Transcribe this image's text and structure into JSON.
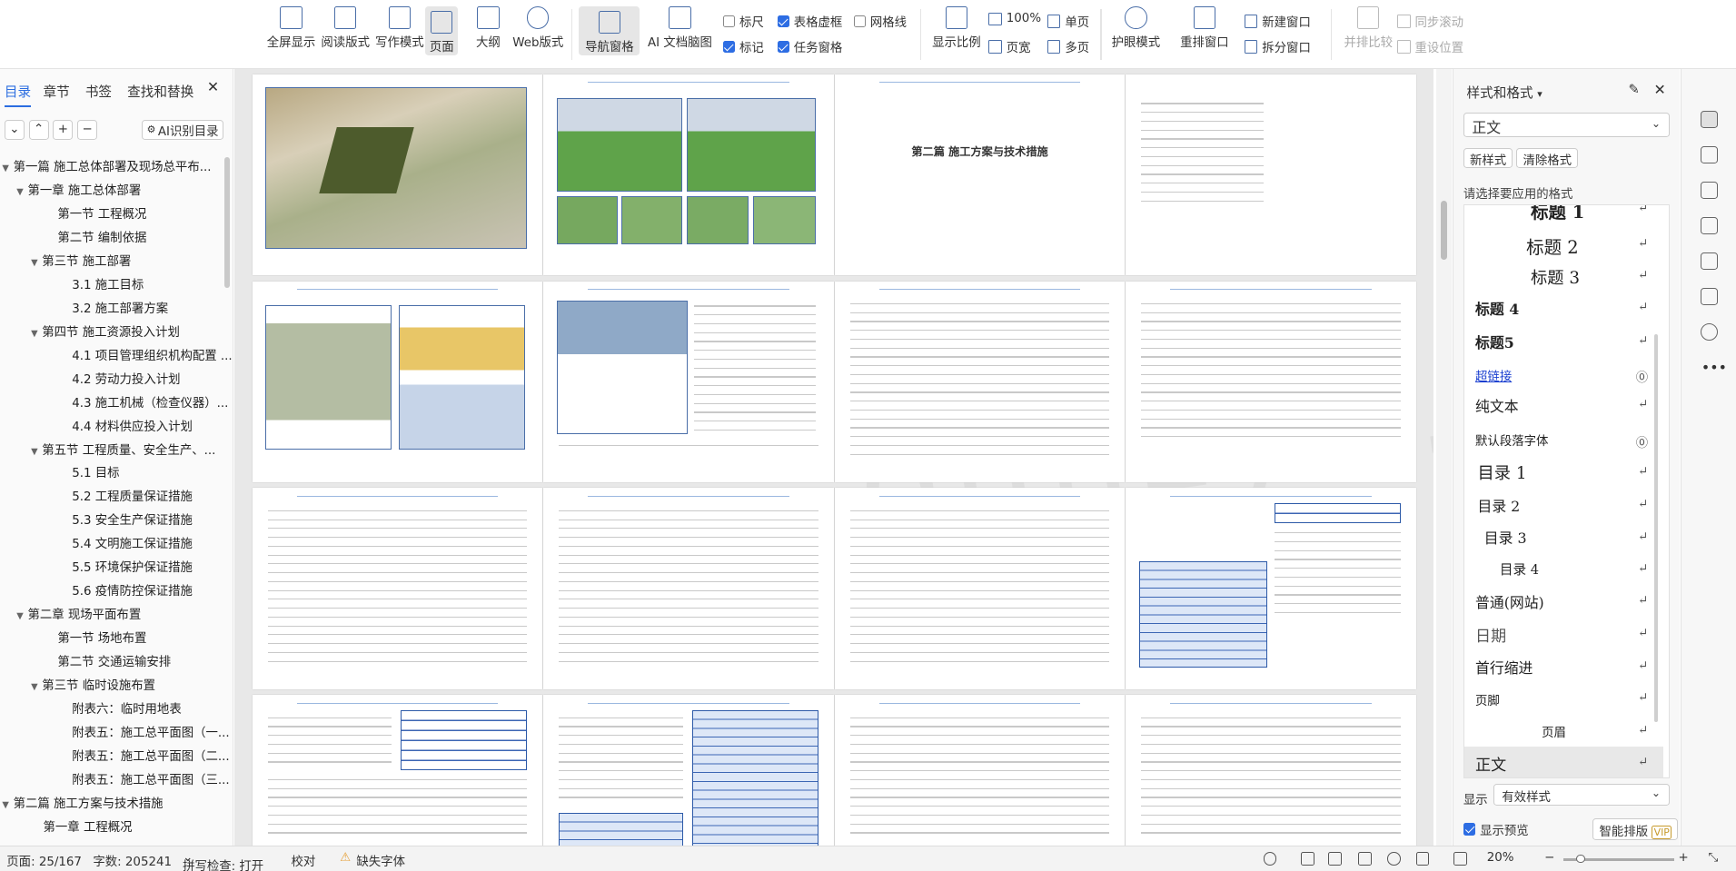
{
  "ribbon": {
    "fullscreen": "全屏显示",
    "reading": "阅读版式",
    "writing": "写作模式",
    "page": "页面",
    "outline": "大纲",
    "web": "Web版式",
    "nav_pane": "导航窗格",
    "ai_map": "AI 文档脑图",
    "ruler": "标尺",
    "table_dash": "表格虚框",
    "gridlines": "网格线",
    "marks": "标记",
    "task_pane": "任务窗格",
    "display_ratio": "显示比例",
    "zoom100": "100%",
    "page_width": "页宽",
    "single_page": "单页",
    "multi_page": "多页",
    "eye_mode": "护眼模式",
    "rearrange": "重排窗口",
    "new_window": "新建窗口",
    "split_window": "拆分窗口",
    "side_by_side": "并排比较",
    "sync_scroll": "同步滚动",
    "reset_pos": "重设位置"
  },
  "left_panel": {
    "tabs": [
      "目录",
      "章节",
      "书签",
      "查找和替换"
    ],
    "ai_toc": "AI识别目录",
    "toc": [
      {
        "t": "第一篇  施工总体部署及现场总平布...",
        "lvl": 0,
        "arrow": true
      },
      {
        "t": "第一章 施工总体部署",
        "lvl": 1,
        "arrow": true
      },
      {
        "t": "第一节 工程概况",
        "lvl": 2,
        "arrow": false
      },
      {
        "t": "第二节 编制依据",
        "lvl": 2,
        "arrow": false
      },
      {
        "t": "第三节 施工部署",
        "lvl": 2,
        "arrow": true
      },
      {
        "t": "3.1 施工目标",
        "lvl": 3,
        "arrow": false
      },
      {
        "t": "3.2 施工部署方案",
        "lvl": 3,
        "arrow": false
      },
      {
        "t": "第四节 施工资源投入计划",
        "lvl": 2,
        "arrow": true
      },
      {
        "t": "4.1 项目管理组织机构配置 ...",
        "lvl": 3,
        "arrow": false
      },
      {
        "t": "4.2 劳动力投入计划",
        "lvl": 3,
        "arrow": false
      },
      {
        "t": "4.3 施工机械（检查仪器）...",
        "lvl": 3,
        "arrow": false
      },
      {
        "t": "4.4 材料供应投入计划",
        "lvl": 3,
        "arrow": false
      },
      {
        "t": "第五节 工程质量、安全生产、...",
        "lvl": 2,
        "arrow": true
      },
      {
        "t": "5.1 目标",
        "lvl": 3,
        "arrow": false
      },
      {
        "t": "5.2 工程质量保证措施",
        "lvl": 3,
        "arrow": false
      },
      {
        "t": "5.3 安全生产保证措施",
        "lvl": 3,
        "arrow": false
      },
      {
        "t": "5.4 文明施工保证措施",
        "lvl": 3,
        "arrow": false
      },
      {
        "t": "5.5 环境保护保证措施",
        "lvl": 3,
        "arrow": false
      },
      {
        "t": "5.6 疫情防控保证措施",
        "lvl": 3,
        "arrow": false
      },
      {
        "t": "第二章 现场平面布置",
        "lvl": 1,
        "arrow": true
      },
      {
        "t": "第一节 场地布置",
        "lvl": 2,
        "arrow": false
      },
      {
        "t": "第二节 交通运输安排",
        "lvl": 2,
        "arrow": false
      },
      {
        "t": "第三节 临时设施布置",
        "lvl": 2,
        "arrow": true
      },
      {
        "t": "附表六：临时用地表",
        "lvl": 3,
        "arrow": false
      },
      {
        "t": "附表五：施工总平面图（一...",
        "lvl": 3,
        "arrow": false
      },
      {
        "t": "附表五：施工总平面图（二...",
        "lvl": 3,
        "arrow": false
      },
      {
        "t": "附表五：施工总平面图（三...",
        "lvl": 3,
        "arrow": false
      },
      {
        "t": "第二篇 施工方案与技术措施",
        "lvl": 0,
        "arrow": true
      },
      {
        "t": "第一章 工程概况",
        "lvl": 1,
        "arrow": false
      }
    ]
  },
  "canvas": {
    "section_title": "第二篇  施工方案与技术措施"
  },
  "right_panel": {
    "title": "样式和格式",
    "current_style": "正文",
    "new_style": "新样式",
    "clear_format": "清除格式",
    "hint": "请选择要应用的格式",
    "styles": [
      "标题 1",
      "标题 2",
      "标题 3",
      "标题 4",
      "标题5",
      "超链接",
      "纯文本",
      "默认段落字体",
      "目录 1",
      "目录 2",
      "目录 3",
      "目录 4",
      "普通(网站)",
      "日期",
      "首行缩进",
      "页脚",
      "页眉",
      "正文"
    ],
    "show_label": "显示",
    "show_value": "有效样式",
    "preview": "显示预览",
    "smart_layout": "智能排版",
    "vip": "VIP"
  },
  "status": {
    "page": "页面: 25/167",
    "words": "字数: 205241",
    "spell": "拼写检查: 打开",
    "proof": "校对",
    "missing_font": "缺失字体",
    "zoom": "20%"
  },
  "watermark": "oimzyw.cc",
  "colors": {
    "accent": "#2b6de0",
    "table": "#3c66b4"
  }
}
